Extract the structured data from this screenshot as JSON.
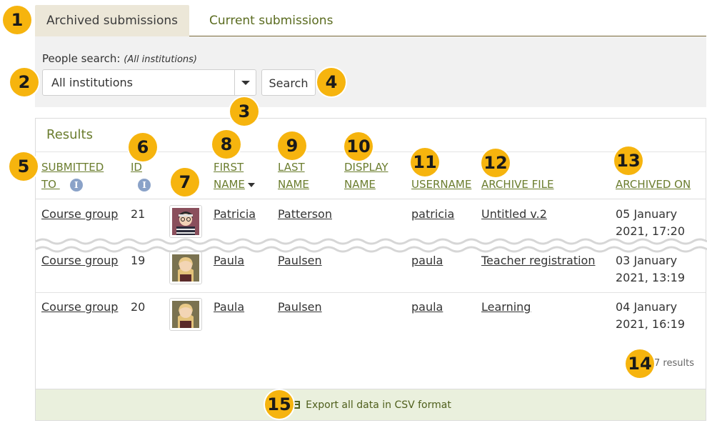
{
  "tabs": [
    {
      "label": "Archived submissions",
      "active": true
    },
    {
      "label": "Current submissions",
      "active": false
    }
  ],
  "search": {
    "label": "People search:",
    "label_note": "(All institutions)",
    "selected": "All institutions",
    "button": "Search"
  },
  "results": {
    "title": "Results",
    "columns": [
      {
        "line1": "SUBMITTED",
        "line2": "TO"
      },
      {
        "line1": "ID",
        "line2": ""
      },
      {
        "line1": "FIRST",
        "line2": "NAME"
      },
      {
        "line1": "LAST",
        "line2": "NAME"
      },
      {
        "line1": "DISPLAY",
        "line2": "NAME"
      },
      {
        "line1": "USERNAME",
        "line2": ""
      },
      {
        "line1": "ARCHIVE FILE",
        "line2": ""
      },
      {
        "line1": "ARCHIVED ON",
        "line2": ""
      }
    ],
    "info_glyph": "i",
    "rows": [
      {
        "submitted_to": "Course group",
        "id": "21",
        "first": "Patricia",
        "last": "Patterson",
        "display": "",
        "username": "patricia",
        "archive": "Untitled v.2",
        "date1": "05 January",
        "date2": "2021, 17:20"
      },
      {
        "submitted_to": "Course group",
        "id": "19",
        "first": "Paula",
        "last": "Paulsen",
        "display": "",
        "username": "paula",
        "archive": "Teacher registration",
        "date1": "03 January",
        "date2": "2021, 13:19"
      },
      {
        "submitted_to": "Course group",
        "id": "20",
        "first": "Paula",
        "last": "Paulsen",
        "display": "",
        "username": "paula",
        "archive": "Learning",
        "date1": "04 January",
        "date2": "2021, 16:19"
      }
    ],
    "count": "7 results",
    "export": "Export all data in CSV format"
  },
  "callouts": [
    "1",
    "2",
    "3",
    "4",
    "5",
    "6",
    "7",
    "8",
    "9",
    "10",
    "11",
    "12",
    "13",
    "14",
    "15"
  ],
  "colors": {
    "accent": "#f6b40e",
    "link": "#5a6e18",
    "tab_active": "#ece7d8",
    "export_bg": "#eaf0dd"
  },
  "icons": {
    "info": "info-icon",
    "sort": "sort-down-icon",
    "dropdown": "chevron-down-icon",
    "export": "table-icon"
  }
}
